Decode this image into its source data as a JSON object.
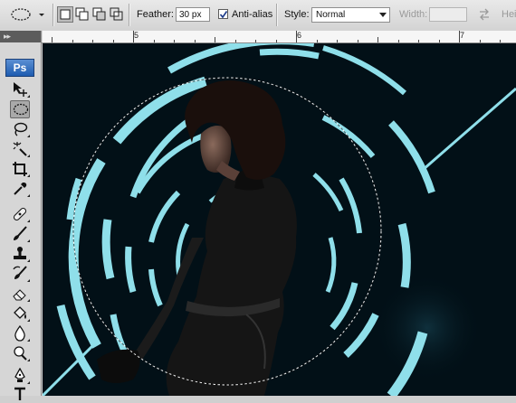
{
  "options_bar": {
    "feather_label": "Feather:",
    "feather_value": "30 px",
    "anti_alias_label": "Anti-alias",
    "anti_alias_checked": true,
    "style_label": "Style:",
    "style_value": "Normal",
    "width_label": "Width:",
    "height_label": "Hei"
  },
  "ruler": {
    "numbers": [
      "5",
      "6",
      "7"
    ]
  },
  "toolbox": {
    "logo": "Ps",
    "tools": [
      "move",
      "elliptical-marquee",
      "lasso",
      "magic-wand",
      "crop",
      "eyedropper",
      "healing-brush",
      "brush",
      "clone-stamp",
      "history-brush",
      "eraser",
      "paint-bucket",
      "blur",
      "dodge",
      "pen",
      "type"
    ],
    "active_tool": "elliptical-marquee"
  },
  "canvas": {
    "background": "#021017",
    "accent": "#8fdfea"
  }
}
